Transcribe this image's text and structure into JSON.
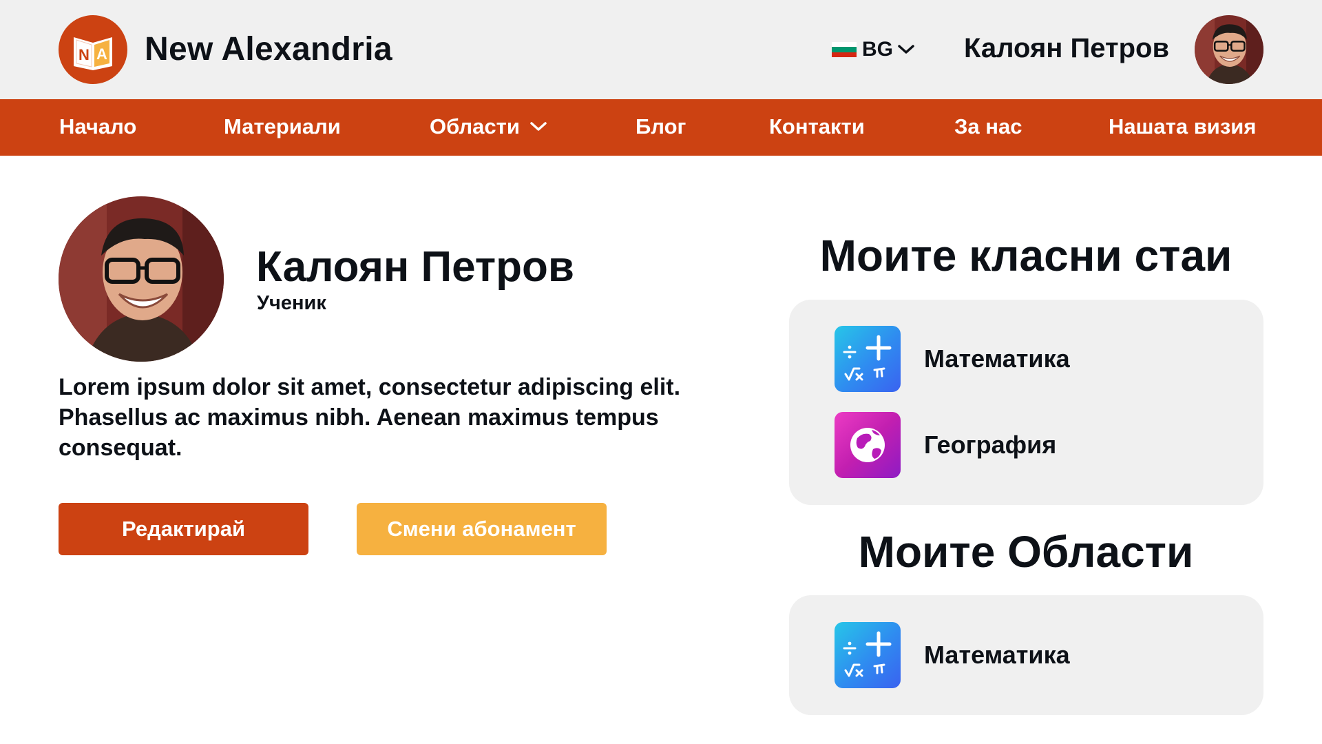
{
  "header": {
    "brand": "New Alexandria",
    "logo_letters": [
      "N",
      "A"
    ],
    "language": {
      "code": "BG",
      "flag_colors": [
        "#ffffff",
        "#00966e",
        "#d62612"
      ]
    },
    "user_name": "Калоян Петров",
    "icons": {
      "language_chevron": "chevron-down-icon",
      "avatar": "user-avatar"
    }
  },
  "nav": {
    "items": [
      {
        "label": "Начало"
      },
      {
        "label": "Материали"
      },
      {
        "label": "Области",
        "dropdown": true
      },
      {
        "label": "Блог"
      },
      {
        "label": "Контакти"
      },
      {
        "label": "За нас"
      },
      {
        "label": "Нашата визия"
      }
    ]
  },
  "profile": {
    "name": "Калоян Петров",
    "role": "Ученик",
    "bio": "Lorem ipsum dolor sit amet, consectetur adipiscing elit. Phasellus ac maximus nibh. Aenean maximus tempus consequat.",
    "edit_label": "Редактирай",
    "subscription_label": "Смени абонамент"
  },
  "classrooms": {
    "title": "Моите класни стаи",
    "items": [
      {
        "label": "Математика",
        "icon": "math-icon"
      },
      {
        "label": "География",
        "icon": "globe-icon"
      }
    ]
  },
  "areas": {
    "title": "Моите Области",
    "items": [
      {
        "label": "Математика",
        "icon": "math-icon"
      }
    ]
  },
  "colors": {
    "brand": "#cc4212",
    "accent": "#f6b140",
    "topbar_bg": "#f0f0f0",
    "card_bg": "#f0f0f0",
    "text": "#0d1117"
  }
}
